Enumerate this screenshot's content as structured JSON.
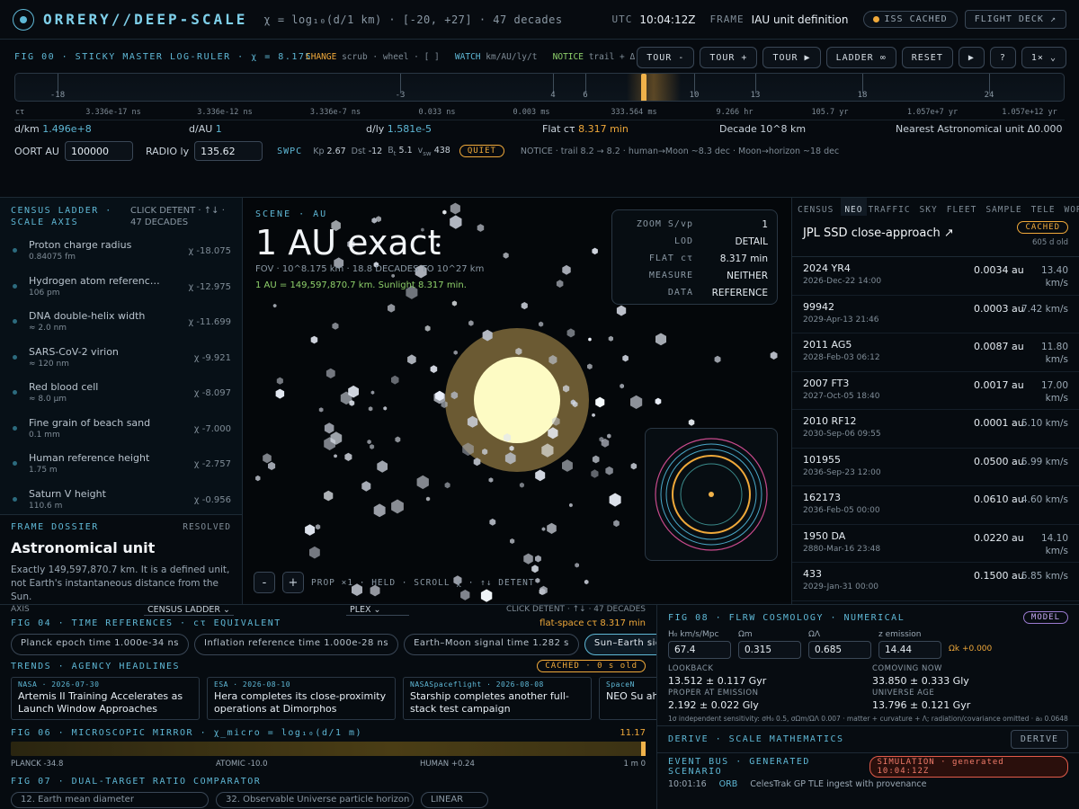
{
  "topbar": {
    "app_title": "ORRERY//DEEP-SCALE",
    "chi_range": "χ = log₁₀(d/1 km) · [-20, +27] · 47 decades",
    "utc_label": "UTC",
    "utc_value": "10:04:12Z",
    "frame_label": "FRAME",
    "frame_value": "IAU unit definition",
    "iss_pill": "ISS CACHED",
    "flight_deck": "FLIGHT DECK ↗"
  },
  "ruler": {
    "heading": "FIG 00 · STICKY MASTER LOG-RULER · χ = 8.175",
    "legend_change": "CHANGE",
    "legend_change_txt": "scrub · wheel · [ ]",
    "legend_watch": "WATCH",
    "legend_watch_txt": "km/AU/ly/t",
    "legend_notice": "NOTICE",
    "legend_notice_txt": "trail + Δ ledger",
    "buttons": [
      "TOUR -",
      "TOUR +",
      "TOUR ▶",
      "LADDER ∞",
      "RESET",
      "▶",
      "?",
      "1× ⌄"
    ],
    "ticks": [
      "-18",
      "-3",
      "4",
      "6",
      "10",
      "13",
      "18",
      "24"
    ],
    "ct_prefix": "cτ",
    "ct_labels": [
      "3.336e-17 ns",
      "3.336e-12 ns",
      "3.336e-7 ns",
      "0.033 ns",
      "0.003 ms",
      "333.564 ms",
      "9.266 hr",
      "105.7 yr",
      "1.057e+7 yr",
      "1.057e+12 yr"
    ],
    "readouts": {
      "dkm_label": "d/km",
      "dkm": "1.496e+8",
      "dau_label": "d/AU",
      "dau": "1",
      "dly_label": "d/ly",
      "dly": "1.581e-5",
      "flat_label": "Flat cτ",
      "flat": "8.317 min",
      "decade": "Decade 10^8 km",
      "nearest": "Nearest Astronomical unit Δ0.000"
    },
    "oort_label": "OORT AU",
    "oort_value": "100000",
    "radio_label": "RADIO ly",
    "radio_value": "135.62",
    "swpc_label": "SWPC",
    "kp_label": "Kp",
    "kp": "2.67",
    "dst_label": "Dst",
    "dst": "-12",
    "bt_label": "B",
    "bt_sub": "t",
    "bt": "5.1",
    "vsw_label": "v",
    "vsw_sub": "sw",
    "vsw": "438",
    "quiet": "QUIET",
    "notice": "NOTICE · trail 8.2 → 8.2 · human→Moon ~8.3 dec · Moon→horizon ~18 dec"
  },
  "census": {
    "title": "CENSUS LADDER · SCALE AXIS",
    "hint": "CLICK DETENT · ↑↓ · 47 DECADES",
    "items": [
      {
        "name": "Proton charge radius",
        "sub": "0.84075 fm",
        "chi": "χ -18.075"
      },
      {
        "name": "Hydrogen atom reference …",
        "sub": "106 pm",
        "chi": "χ -12.975"
      },
      {
        "name": "DNA double-helix width",
        "sub": "≈ 2.0 nm",
        "chi": "χ -11.699"
      },
      {
        "name": "SARS-CoV-2 virion",
        "sub": "≈ 120 nm",
        "chi": "χ -9.921"
      },
      {
        "name": "Red blood cell",
        "sub": "≈ 8.0 μm",
        "chi": "χ -8.097"
      },
      {
        "name": "Fine grain of beach sand",
        "sub": "0.1 mm",
        "chi": "χ -7.000"
      },
      {
        "name": "Human reference height",
        "sub": "1.75 m",
        "chi": "χ -2.757"
      },
      {
        "name": "Saturn V height",
        "sub": "110.6 m",
        "chi": "χ -0.956"
      }
    ]
  },
  "dossier": {
    "label": "FRAME DOSSIER",
    "status": "RESOLVED",
    "title": "Astronomical unit",
    "desc": "Exactly 149,597,870.7 km. It is a defined unit, not Earth's instantaneous distance from the Sun."
  },
  "scene": {
    "label": "SCENE · AU",
    "title": "1 AU exact",
    "fov": "FOV · 10^8.175 km · 18.8 DECADES TO 10^27 km",
    "note": "1 AU = 149,597,870.7 km. Sunlight 8.317 min.",
    "zoom_rows": [
      {
        "k": "ZOOM S/vp",
        "v": "1"
      },
      {
        "k": "LOD",
        "v": "DETAIL"
      },
      {
        "k": "FLAT cτ",
        "v": "8.317 min"
      },
      {
        "k": "MEASURE",
        "v": "NEITHER"
      },
      {
        "k": "DATA",
        "v": "REFERENCE"
      }
    ],
    "minus": "-",
    "plus": "+",
    "ctrl_hint": "PROP ×1 · HELD · SCROLL χ · ↑↓ DETENT"
  },
  "neo": {
    "tabs": [
      "CENSUS",
      "NEO",
      "TRAFFIC",
      "SKY",
      "FLEET",
      "SAMPLE",
      "TELE",
      "WORLD"
    ],
    "title": "JPL SSD close-approach ↗",
    "cached": "CACHED",
    "age": "605 d old",
    "rows": [
      {
        "n": "2024 YR4",
        "d": "2026-Dec-22 14:00",
        "au": "0.0034 au",
        "sp": "13.40 km/s"
      },
      {
        "n": "99942",
        "d": "2029-Apr-13 21:46",
        "au": "0.0003 au",
        "sp": "7.42 km/s"
      },
      {
        "n": "2011 AG5",
        "d": "2028-Feb-03 06:12",
        "au": "0.0087 au",
        "sp": "11.80 km/s"
      },
      {
        "n": "2007 FT3",
        "d": "2027-Oct-05 18:40",
        "au": "0.0017 au",
        "sp": "17.00 km/s"
      },
      {
        "n": "2010 RF12",
        "d": "2030-Sep-06 09:55",
        "au": "0.0001 au",
        "sp": "5.10 km/s"
      },
      {
        "n": "101955",
        "d": "2036-Sep-23 12:00",
        "au": "0.0500 au",
        "sp": "5.99 km/s"
      },
      {
        "n": "162173",
        "d": "2036-Feb-05 00:00",
        "au": "0.0610 au",
        "sp": "4.60 km/s"
      },
      {
        "n": "1950 DA",
        "d": "2880-Mar-16 23:48",
        "au": "0.0220 au",
        "sp": "14.10 km/s"
      },
      {
        "n": "433",
        "d": "2029-Jan-31 00:00",
        "au": "0.1500 au",
        "sp": "5.85 km/s"
      }
    ]
  },
  "axis_row": {
    "axis": "AXIS",
    "sel1": "CENSUS LADDER ⌄",
    "sel2": "PLEX ⌄",
    "hint": "CLICK DETENT · ↑↓ · 47 DECADES"
  },
  "times": {
    "heading": "FIG 04 · TIME REFERENCES · cτ EQUIVALENT",
    "flat": "flat-space cτ 8.317 min",
    "chips": [
      "Planck epoch time 1.000e-34 ns",
      "Inflation reference time 1.000e-28 ns",
      "Earth–Moon signal time 1.282 s",
      "Sun–Earth signal"
    ]
  },
  "trends": {
    "heading": "TRENDS · AGENCY HEADLINES",
    "cached": "CACHED · 0 s old",
    "items": [
      {
        "src": "NASA · 2026-07-30",
        "hl": "Artemis II Training Accelerates as Launch Window Approaches"
      },
      {
        "src": "ESA · 2026-08-10",
        "hl": "Hera completes its close-proximity operations at Dimorphos"
      },
      {
        "src": "NASASpaceflight · 2026-08-08",
        "hl": "Starship completes another full-stack test campaign"
      },
      {
        "src": "SpaceN",
        "hl": "NEO Su ahead"
      }
    ]
  },
  "micro": {
    "heading": "FIG 06 · MICROSCOPIC MIRROR · χ_micro = log₁₀(d/1 m)",
    "value": "11.17",
    "labels": [
      "PLANCK -34.8",
      "ATOMIC -10.0",
      "HUMAN +0.24",
      "1 m 0"
    ]
  },
  "ratio": {
    "heading": "FIG 07 · DUAL-TARGET RATIO COMPARATOR",
    "opts": [
      "12. Earth mean diameter",
      "32. Observable Universe particle horizon",
      "LINEAR"
    ]
  },
  "cosmo": {
    "heading": "FIG 08 · FLRW COSMOLOGY · NUMERICAL",
    "badge": "MODEL",
    "inputs": [
      {
        "k": "H₀ km/s/Mpc",
        "v": "67.4"
      },
      {
        "k": "Ωm",
        "v": "0.315"
      },
      {
        "k": "ΩΛ",
        "v": "0.685"
      },
      {
        "k": "z emission",
        "v": "14.44"
      }
    ],
    "omega_k": "Ωk +0.000",
    "results": [
      {
        "k": "LOOKBACK",
        "v": "13.512 ± 0.117 Gyr"
      },
      {
        "k": "COMOVING NOW",
        "v": "33.850 ± 0.333 Gly"
      },
      {
        "k": "PROPER AT EMISSION",
        "v": "2.192 ± 0.022 Gly"
      },
      {
        "k": "UNIVERSE AGE",
        "v": "13.796 ± 0.121 Gyr"
      }
    ],
    "foot": "1σ independent sensitivity: σH₀ 0.5, σΩm/ΩΛ 0.007 · matter + curvature + Λ; radiation/covariance omitted · a₀ 0.0648"
  },
  "derive": {
    "heading": "DERIVE · SCALE MATHEMATICS",
    "button": "DERIVE"
  },
  "events": {
    "heading": "EVENT BUS · GENERATED SCENARIO",
    "badge": "SIMULATION · generated 10:04:12Z",
    "time": "10:01:16",
    "src": "ORB",
    "msg": "CelesTrak GP TLE ingest with provenance"
  },
  "colors": {
    "accent": "#5fb8d6",
    "amber": "#f0a93a",
    "green": "#8fd16b",
    "sun": "#fdfbc4",
    "corona": "#6b5a33"
  }
}
